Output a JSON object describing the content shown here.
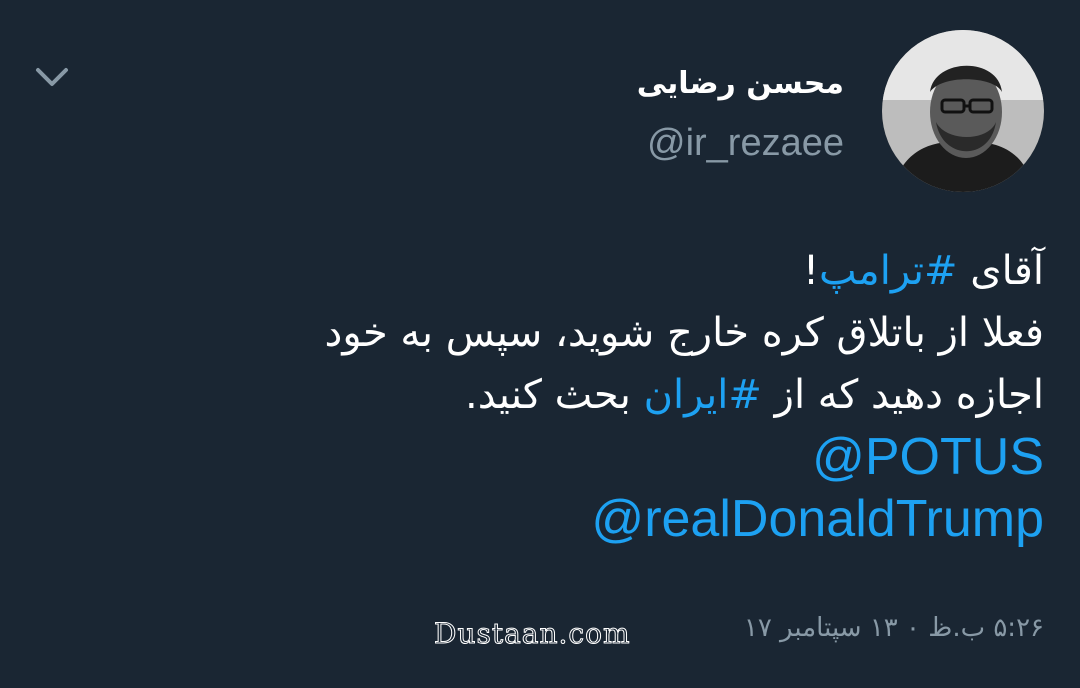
{
  "author": {
    "display_name": "محسن رضایی",
    "handle": "@ir_rezaee",
    "avatar_icon": "person-portrait"
  },
  "menu": {
    "icon": "chevron-down-icon"
  },
  "tweet": {
    "line1_before": "آقای ",
    "hashtag1": "#ترامپ",
    "line1_after": "!",
    "line2": "فعلا از باتلاق کره خارج شوید، سپس به خود",
    "line3_before": "اجازه دهید که از ",
    "hashtag2": "#ایران",
    "line3_after": " بحث کنید.",
    "mention1": "@POTUS",
    "mention2": "@realDonaldTrump"
  },
  "meta": {
    "timestamp": "۵:۲۶ ب.ظ ۰ ۱۳ سپتامبر ۱۷"
  },
  "watermark": "Dustaan.com",
  "colors": {
    "background": "#1a2633",
    "link": "#1da1f2",
    "secondary_text": "#8899a6",
    "primary_text": "#ffffff"
  }
}
